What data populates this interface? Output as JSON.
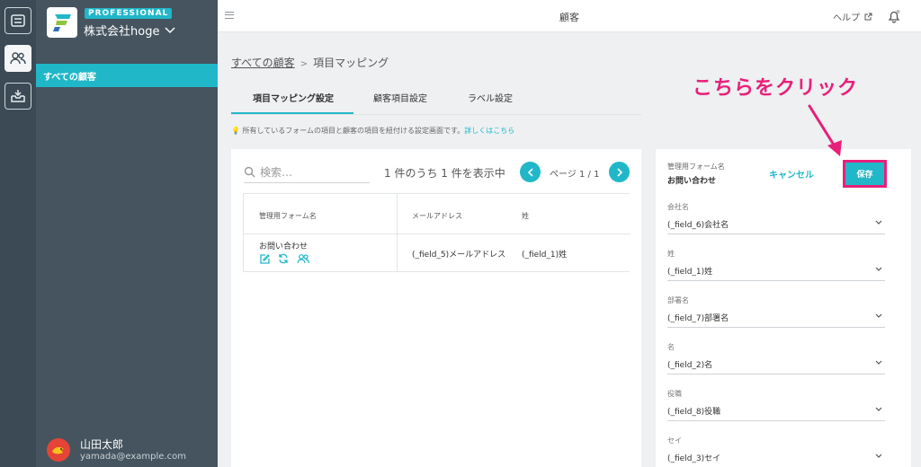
{
  "sidebar": {
    "plan_badge": "PROFESSIONAL",
    "company": "株式会社hoge",
    "nav": [
      {
        "label": "すべての顧客"
      }
    ],
    "user": {
      "name": "山田太郎",
      "email": "yamada@example.com"
    }
  },
  "header": {
    "title": "顧客",
    "help": "ヘルプ"
  },
  "breadcrumb": {
    "parent": "すべての顧客",
    "separator": ">",
    "current": "項目マッピング"
  },
  "tabs": [
    {
      "label": "項目マッピング設定",
      "active": true
    },
    {
      "label": "顧客項目設定"
    },
    {
      "label": "ラベル設定"
    }
  ],
  "hint": {
    "text": "所有しているフォームの項目と顧客の項目を紐付ける設定画面です。",
    "link": "詳しくはこちら"
  },
  "list": {
    "search_placeholder": "検索…",
    "count_text": "1 件のうち 1 件を表示中",
    "page_info": "ページ 1 / 1",
    "columns": [
      "管理用フォーム名",
      "メールアドレス",
      "姓"
    ],
    "rows": [
      {
        "form": "お問い合わせ",
        "email": "(_field_5)メールアドレス",
        "last_name": "(_field_1)姓"
      }
    ]
  },
  "mapping": {
    "form_label": "管理用フォーム名",
    "form_value": "お問い合わせ",
    "cancel": "キャンセル",
    "save": "保存",
    "fields": [
      {
        "label": "会社名",
        "value": "(_field_6)会社名"
      },
      {
        "label": "姓",
        "value": "(_field_1)姓"
      },
      {
        "label": "部署名",
        "value": "(_field_7)部署名"
      },
      {
        "label": "名",
        "value": "(_field_2)名"
      },
      {
        "label": "役職",
        "value": "(_field_8)役職"
      },
      {
        "label": "セイ",
        "value": "(_field_3)セイ"
      }
    ]
  },
  "annotation": {
    "text": "こちらをクリック"
  },
  "colors": {
    "accent": "#20b7c9",
    "highlight": "#e8207a",
    "sidebar": "#45545f",
    "rail": "#3b4a55"
  }
}
